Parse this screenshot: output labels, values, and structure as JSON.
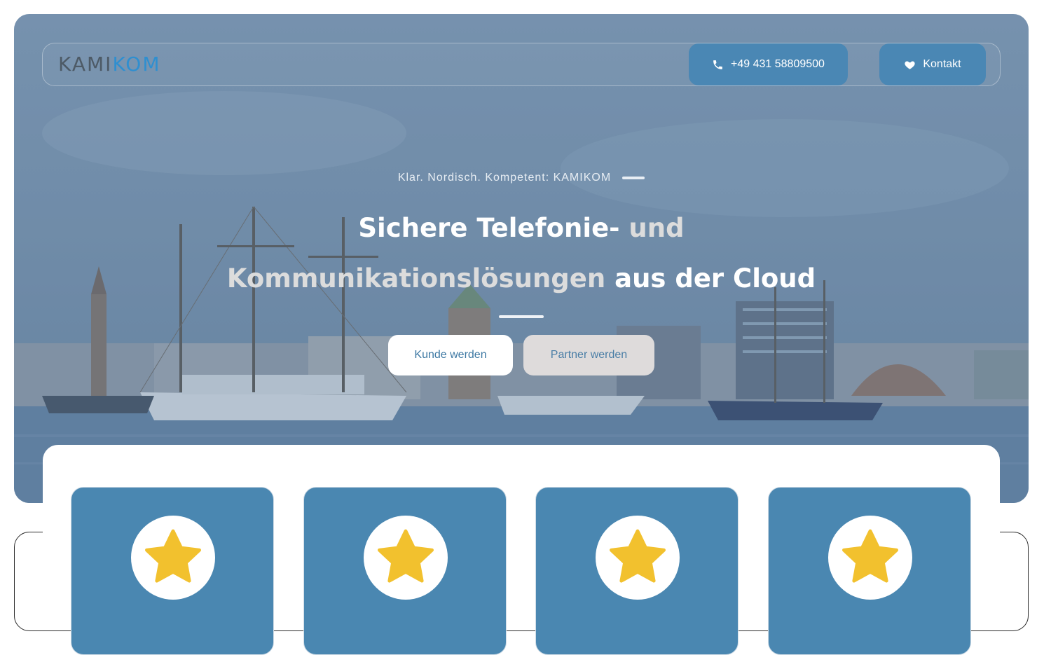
{
  "header": {
    "logo": {
      "part1": "KAMI",
      "part2": "KOM"
    },
    "phone_label": "+49 431 58809500",
    "contact_label": "Kontakt"
  },
  "hero": {
    "tagline": "Klar. Nordisch. Kompetent: KAMIKOM",
    "headline": {
      "part1": "Sichere Telefonie-",
      "part2": "und",
      "part3": "Kommunikationslösungen",
      "part4": "aus der Cloud"
    },
    "cta_primary": "Kunde werden",
    "cta_secondary": "Partner werden"
  },
  "cards": [
    {
      "icon": "star-icon"
    },
    {
      "icon": "star-icon"
    },
    {
      "icon": "star-icon"
    },
    {
      "icon": "star-icon"
    }
  ],
  "colors": {
    "brand_blue": "#4a87b4",
    "logo_grey": "#4d5a66",
    "logo_blue": "#2f8fd0",
    "star_yellow": "#f2c12e"
  }
}
